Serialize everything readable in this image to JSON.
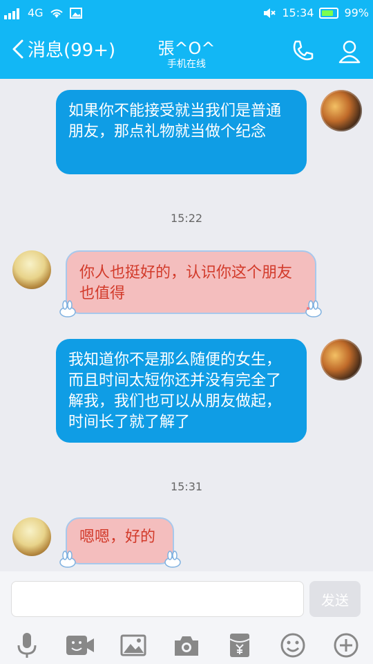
{
  "status_bar": {
    "network": "4G",
    "time": "15:34",
    "battery": "99%",
    "battery_level": 0.99
  },
  "header": {
    "back_label": "消息(99+)",
    "contact_name": "張^O^",
    "contact_status": "手机在线"
  },
  "messages": [
    {
      "side": "sent",
      "text": "如果你不能接受就当我们是普通朋友，那点礼物就当做个纪念"
    },
    {
      "time": "15:22"
    },
    {
      "side": "recv",
      "text": "你人也挺好的，认识你这个朋友也值得"
    },
    {
      "side": "sent",
      "text": "我知道你不是那么随便的女生，而且时间太短你还并没有完全了解我，我们也可以从朋友做起，时间长了就了解了"
    },
    {
      "time": "15:31"
    },
    {
      "side": "recv",
      "text": "嗯嗯，好的"
    }
  ],
  "composer": {
    "input_value": "",
    "send_label": "发送"
  },
  "icons": {
    "back": "chevron-left-icon",
    "call": "phone-icon",
    "profile": "user-icon",
    "voice": "microphone-icon",
    "video": "video-icon",
    "image": "image-icon",
    "camera": "camera-icon",
    "redpacket": "red-packet-icon",
    "emoji": "emoji-icon",
    "more": "plus-icon"
  },
  "colors": {
    "header_bg": "#12b7f5",
    "sent_bubble": "#0f9de5",
    "recv_bubble": "#f4bebe",
    "recv_text": "#d23a2a",
    "chat_bg": "#ebecf1"
  }
}
